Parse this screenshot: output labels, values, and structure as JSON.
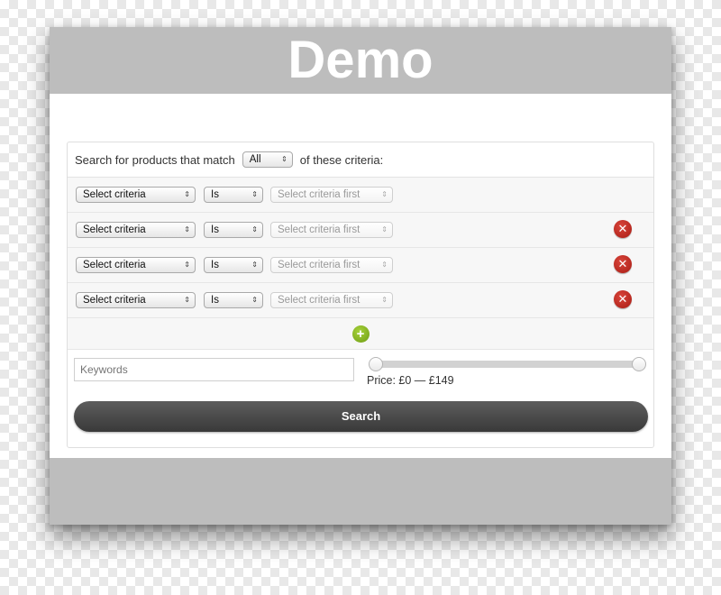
{
  "header": {
    "title": "Demo"
  },
  "filter": {
    "prefix": "Search for products that match",
    "match_value": "All",
    "suffix": "of these criteria:"
  },
  "rows": [
    {
      "criteria": "Select criteria",
      "operator": "Is",
      "value": "Select criteria first",
      "removable": false
    },
    {
      "criteria": "Select criteria",
      "operator": "Is",
      "value": "Select criteria first",
      "removable": true
    },
    {
      "criteria": "Select criteria",
      "operator": "Is",
      "value": "Select criteria first",
      "removable": true
    },
    {
      "criteria": "Select criteria",
      "operator": "Is",
      "value": "Select criteria first",
      "removable": true
    }
  ],
  "icons": {
    "dropdown": "updown-arrows-icon",
    "remove": "remove-circle-icon",
    "add": "add-circle-icon"
  },
  "keywords": {
    "placeholder": "Keywords"
  },
  "price": {
    "label": "Price: £0 — £149",
    "min_fraction": 0,
    "max_fraction": 1
  },
  "search_button": {
    "label": "Search"
  },
  "colors": {
    "header": "#bdbdbd",
    "remove": "#b5261c",
    "add": "#8bbb24",
    "search_button": "#474747"
  }
}
